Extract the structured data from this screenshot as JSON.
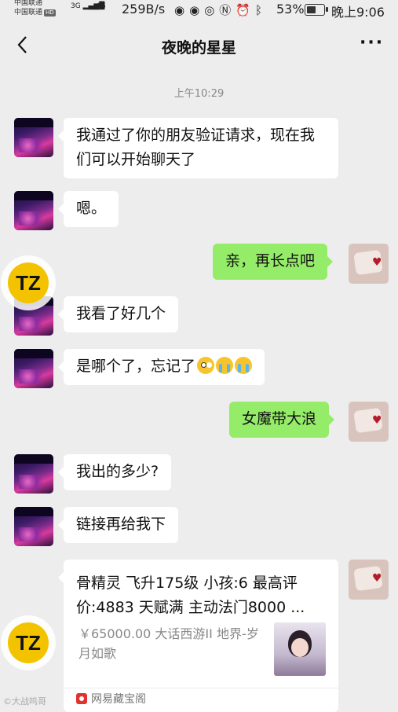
{
  "status_bar": {
    "carrier1": "中国联通",
    "carrier2": "中国联通",
    "hd": "HD",
    "net1": "3G",
    "net2": "4G",
    "net_speed": "259B/s",
    "icons": [
      "chrome-icon",
      "chrome-icon",
      "eye-icon",
      "nfc-icon",
      "alarm-icon",
      "bluetooth-icon"
    ],
    "battery": "53%",
    "time": "晚上9:06"
  },
  "header": {
    "title": "夜晚的星星"
  },
  "timestamp": "上午10:29",
  "messages": [
    {
      "side": "left",
      "text": "我通过了你的朋友验证请求，现在我们可以开始聊天了"
    },
    {
      "side": "left",
      "text": "嗯。"
    },
    {
      "side": "right",
      "text": "亲，再长点吧"
    },
    {
      "side": "left",
      "text": "我看了好几个"
    },
    {
      "side": "left",
      "text": "是哪个了，忘记了",
      "emojis": [
        "flushed",
        "cry",
        "cry"
      ]
    },
    {
      "side": "right",
      "text": "女魔带大浪"
    },
    {
      "side": "left",
      "text": "我出的多少?"
    },
    {
      "side": "left",
      "text": "链接再给我下"
    }
  ],
  "link_card": {
    "title": "骨精灵 飞升175级 小孩:6 最高评价:4883 天赋满 主动法门8000 ...",
    "desc": "￥65000.00 大话西游II 地界-岁月如歌",
    "source": "网易藏宝阁"
  },
  "overlay_badge": "TZ",
  "watermark": "©大战鸣哥"
}
